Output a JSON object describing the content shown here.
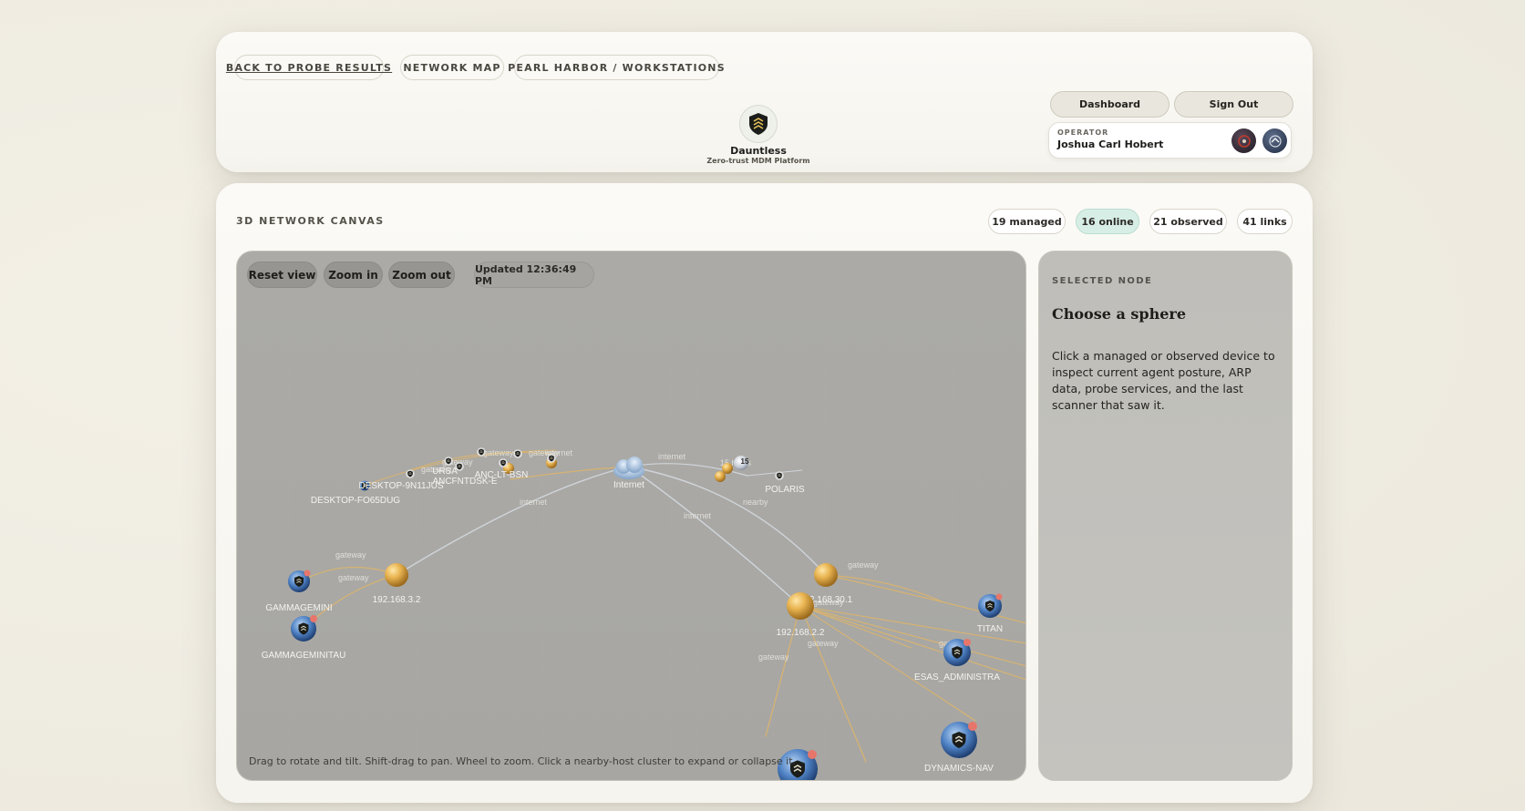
{
  "breadcrumbs": {
    "back": "BACK TO PROBE RESULTS",
    "map": "NETWORK MAP",
    "location": "PEARL HARBOR / WORKSTATIONS"
  },
  "brand": {
    "name": "Dauntless",
    "tagline": "Zero-trust MDM Platform"
  },
  "nav": {
    "dashboard": "Dashboard",
    "sign_out": "Sign Out"
  },
  "operator": {
    "label": "OPERATOR",
    "name": "Joshua Carl Hobert"
  },
  "canvas": {
    "title": "3D NETWORK CANVAS",
    "stats": {
      "managed": "19 managed",
      "online": "16 online",
      "observed": "21 observed",
      "links": "41 links"
    },
    "controls": {
      "reset": "Reset view",
      "zoom_in": "Zoom in",
      "zoom_out": "Zoom out",
      "updated": "Updated 12:36:49 PM"
    },
    "hint": "Drag to rotate and tilt. Shift-drag to pan. Wheel to zoom. Click a nearby-host cluster to expand or collapse it.",
    "nodes": {
      "internet": "Internet",
      "gw_3_2": "192.168.3.2",
      "gw_30_1": "192.168.30.1",
      "gw_2_2": "192.168.2.2",
      "gammagemini": "GAMMAGEMINI",
      "gammageminitau": "GAMMAGEMINITAU",
      "titan": "TITAN",
      "esas": "ESAS_ADMINISTRA",
      "dynamics": "DYNAMICS-NAV",
      "polaris": "POLARIS",
      "desktop_fo": "DESKTOP-FO65DUG",
      "desktop_9n": "DESKTOP-9N11JUS",
      "ancfntdsk": "ANCFNTDSK-E",
      "ursa": "URSA",
      "anc_lt": "ANC-LT-BSN",
      "cluster_count": "15"
    },
    "edges": {
      "gateway": "gateway",
      "internet": "internet",
      "hosts": "15 hosts",
      "nearby": "nearby"
    }
  },
  "selected": {
    "label": "SELECTED NODE",
    "title": "Choose a sphere",
    "body": "Click a managed or observed device to inspect current agent posture, ARP data, probe services, and the last scanner that saw it."
  }
}
